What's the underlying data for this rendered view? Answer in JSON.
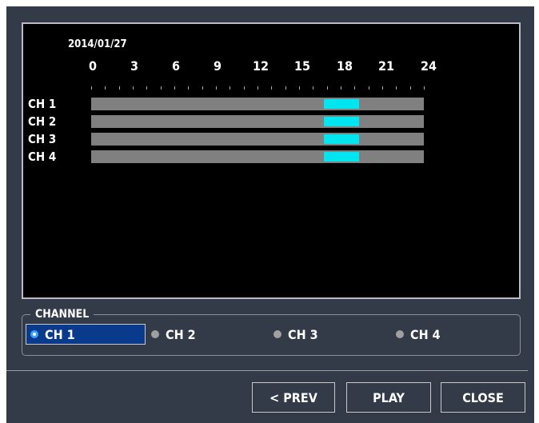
{
  "timeline": {
    "date": "2014/01/27",
    "hours": [
      "0",
      "3",
      "6",
      "9",
      "12",
      "15",
      "18",
      "21",
      "24"
    ],
    "channels": [
      {
        "label": "CH 1",
        "recordings": [
          {
            "start": 16.8,
            "end": 19.3
          }
        ]
      },
      {
        "label": "CH 2",
        "recordings": [
          {
            "start": 16.8,
            "end": 19.3
          }
        ]
      },
      {
        "label": "CH 3",
        "recordings": [
          {
            "start": 16.8,
            "end": 19.3
          }
        ]
      },
      {
        "label": "CH 4",
        "recordings": [
          {
            "start": 16.8,
            "end": 19.3
          }
        ]
      }
    ],
    "recording_color": "#00e5f0",
    "bar_color": "#808080"
  },
  "channel_select": {
    "legend": "CHANNEL",
    "options": [
      "CH 1",
      "CH 2",
      "CH 3",
      "CH 4"
    ],
    "selected": "CH 1"
  },
  "buttons": {
    "prev": "< PREV",
    "play": "PLAY",
    "close": "CLOSE"
  }
}
